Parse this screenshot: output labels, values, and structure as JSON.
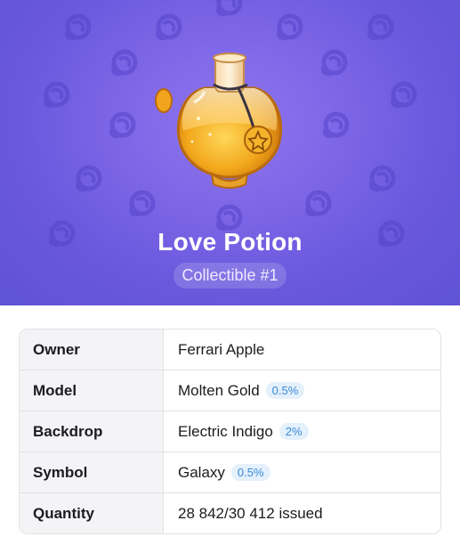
{
  "gift": {
    "name": "Love Potion",
    "collectible_label": "Collectible #1",
    "icon": "love-potion-gift-icon",
    "pattern_icon": "galaxy-symbol-icon",
    "backdrop_color": "#7d66e6"
  },
  "attributes": [
    {
      "label": "Owner",
      "value": "Ferrari Apple"
    },
    {
      "label": "Model",
      "value": "Molten Gold",
      "rarity": "0.5%"
    },
    {
      "label": "Backdrop",
      "value": "Electric Indigo",
      "rarity": "2%"
    },
    {
      "label": "Symbol",
      "value": "Galaxy",
      "rarity": "0.5%"
    },
    {
      "label": "Quantity",
      "value": "28 842/30 412 issued"
    }
  ],
  "colors": {
    "badge_bg": "#e4f0fb",
    "badge_text": "#3a8bd6",
    "label_bg": "#f4f4f6"
  }
}
